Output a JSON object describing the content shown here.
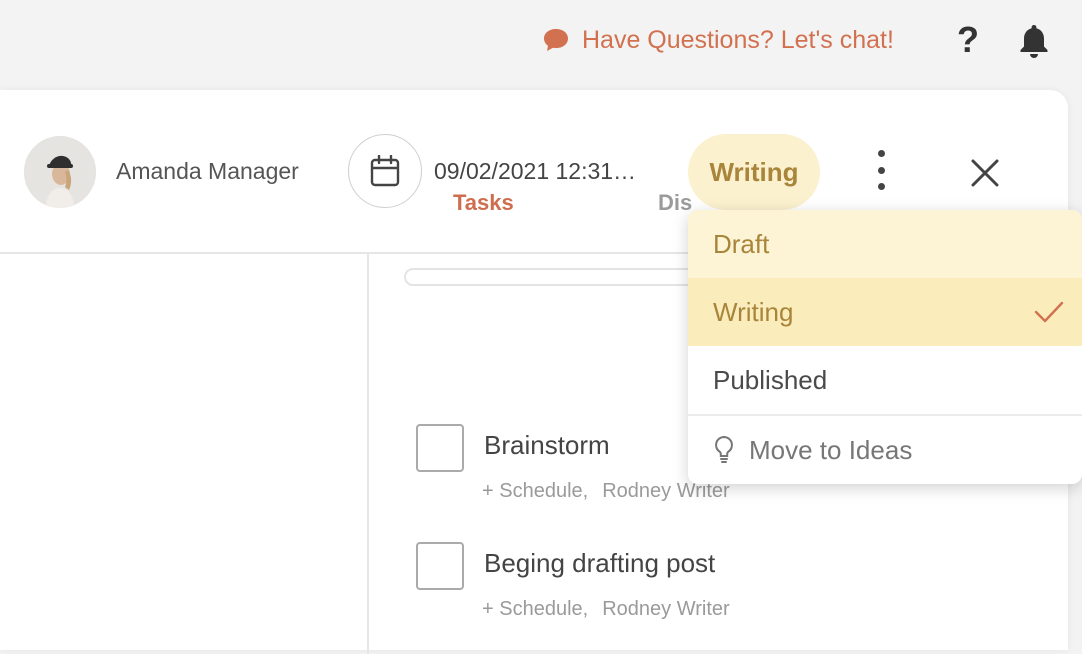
{
  "topbar": {
    "chat_label": "Have Questions? Let's chat!",
    "help_glyph": "?"
  },
  "header": {
    "owner_name": "Amanda Manager",
    "date_text": "09/02/2021 12:31…",
    "status": "Writing"
  },
  "tabs": [
    {
      "label": "Tasks",
      "active": true
    },
    {
      "label": "Dis",
      "active": false
    }
  ],
  "tasks": [
    {
      "title": "Brainstorm",
      "schedule": "+ Schedule,",
      "assignee": "Rodney Writer"
    },
    {
      "title": "Beging drafting post",
      "schedule": "+ Schedule,",
      "assignee": "Rodney Writer"
    }
  ],
  "status_menu": {
    "items": [
      {
        "label": "Draft",
        "selected": false
      },
      {
        "label": "Writing",
        "selected": true
      },
      {
        "label": "Published",
        "selected": false
      }
    ],
    "move_label": "Move to Ideas"
  },
  "colors": {
    "accent": "#cf6e4f",
    "status_gold": "#a8853a",
    "pill_bg": "#fbf1cf"
  },
  "icons": [
    "chat-bubble-icon",
    "help-icon",
    "bell-icon",
    "calendar-icon",
    "more-vertical-icon",
    "close-icon",
    "check-icon",
    "lightbulb-icon"
  ]
}
